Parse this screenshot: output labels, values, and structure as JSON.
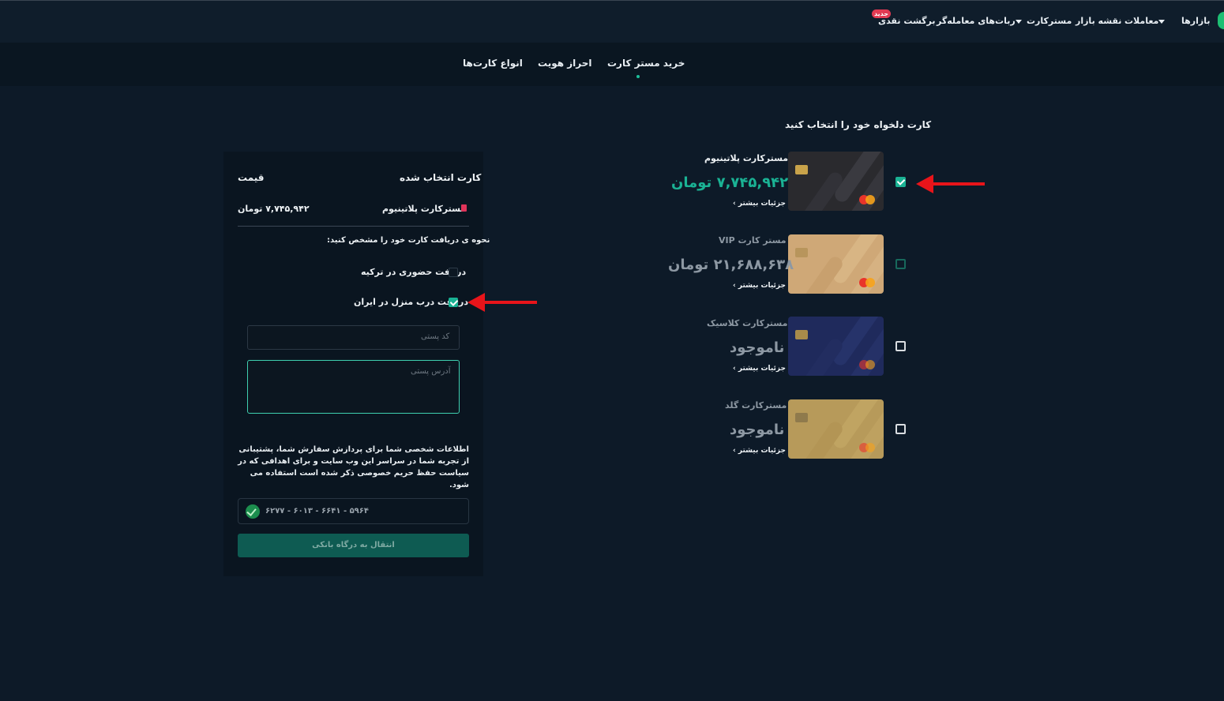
{
  "nav": {
    "items": [
      "بازارها",
      "معاملات",
      "نقشه بازار",
      "مسترکارت",
      "ربات‌های معامله‌گر",
      "برگشت نقدی"
    ],
    "badge": "جدید"
  },
  "tabs": [
    "خرید مستر کارت",
    "احراز هویت",
    "انواع کارت‌ها"
  ],
  "panel": {
    "selected_card_label": "کارت انتخاب شده",
    "price_label": "قیمت",
    "selected_card_name": "مسترکارت پلاتینیوم",
    "selected_card_price": "۷,۷۴۵,۹۴۲ تومان",
    "delivery_question": "نحوه ی دریافت کارت خود را مشخص کنید:",
    "options": [
      {
        "label": "دریافت حضوری در ترکیه",
        "checked": false
      },
      {
        "label": "دریافت درب منزل در ایران",
        "checked": true
      }
    ],
    "postal_code_placeholder": "کد پستی",
    "address_placeholder": "آدرس پستی",
    "privacy_note": "اطلاعات شخصی شما برای پردازش سفارش شما، پشتیبانی از تجربه شما در سراسر این وب سایت و برای اهدافی که در سیاست حفظ حریم خصوصی ذکر شده است استفاده می شود.",
    "bank_card_number": "۶۲۷۷ - ۶۰۱۳ - ۶۶۴۱ - ۵۹۶۴",
    "submit_label": "انتقال به درگاه بانکی"
  },
  "cards_section": {
    "title": "کارت دلخواه خود را انتخاب کنید",
    "more_label": "جزئیات بیشتر ›",
    "cards": [
      {
        "name": "مسترکارت پلاتینیوم",
        "price": "۷,۷۴۵,۹۴۲ تومان",
        "checked": true,
        "theme": "platinum"
      },
      {
        "name": "مستر کارت VIP",
        "price": "۲۱,۶۸۸,۶۳۸ تومان",
        "checked": false,
        "theme": "vip"
      },
      {
        "name": "مسترکارت کلاسیک",
        "price": "ناموجود",
        "checked": false,
        "theme": "classic"
      },
      {
        "name": "مسترکارت گلد",
        "price": "ناموجود",
        "checked": false,
        "theme": "gold"
      }
    ]
  },
  "colors": {
    "accent": "#1ab294",
    "background": "#0d1a28",
    "annotation": "#e8141a"
  }
}
